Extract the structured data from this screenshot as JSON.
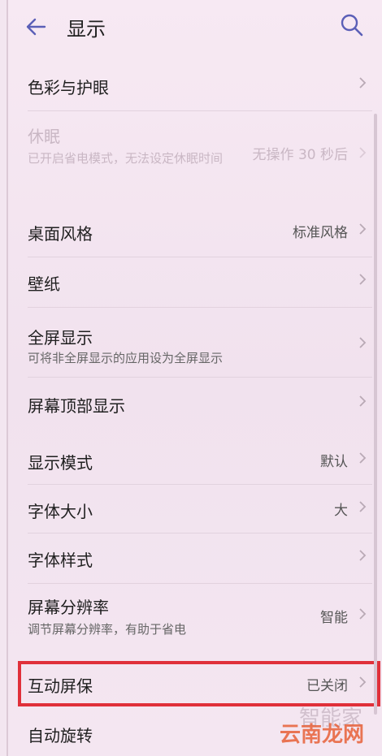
{
  "header": {
    "title": "显示",
    "back_icon": "arrow-left-icon",
    "search_icon": "search-icon",
    "accent_color": "#5b5fb7"
  },
  "settings": [
    {
      "label": "色彩与护眼",
      "sub": "",
      "value": ""
    },
    {
      "label": "休眠",
      "sub": "已开启省电模式，无法设定休眠时间",
      "value": "无操作 30 秒后",
      "disabled": true
    },
    {
      "label": "桌面风格",
      "sub": "",
      "value": "标准风格"
    },
    {
      "label": "壁纸",
      "sub": "",
      "value": ""
    },
    {
      "label": "全屏显示",
      "sub": "可将非全屏显示的应用设为全屏显示",
      "value": ""
    },
    {
      "label": "屏幕顶部显示",
      "sub": "",
      "value": ""
    },
    {
      "label": "显示模式",
      "sub": "",
      "value": "默认"
    },
    {
      "label": "字体大小",
      "sub": "",
      "value": "大"
    },
    {
      "label": "字体样式",
      "sub": "",
      "value": ""
    },
    {
      "label": "屏幕分辨率",
      "sub": "调节屏幕分辨率，有助于省电",
      "value": "智能"
    },
    {
      "label": "互动屏保",
      "sub": "",
      "value": "已关闭"
    },
    {
      "label": "自动旋转",
      "sub": "",
      "value": ""
    }
  ],
  "watermark": {
    "text": "云南龙网",
    "ghost_text": "智能家",
    "color": "#e65f37"
  }
}
